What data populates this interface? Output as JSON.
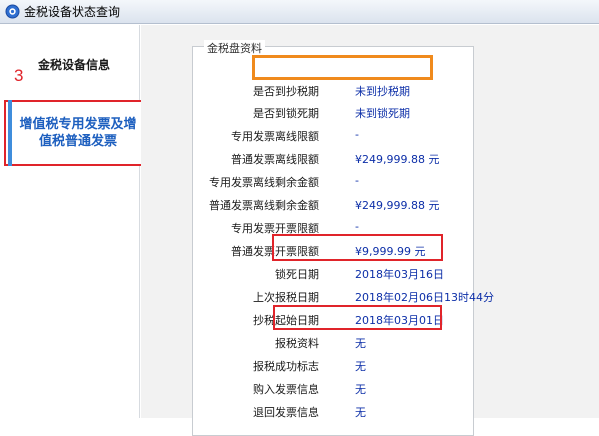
{
  "window": {
    "title": "金税设备状态查询"
  },
  "sidebar": {
    "header": "金税设备信息",
    "annotation": "3",
    "active_item": "增值税专用发票及增值税普通发票"
  },
  "panel": {
    "legend": "金税盘资料",
    "rows": [
      {
        "label": "是否到抄税期",
        "value": "未到抄税期"
      },
      {
        "label": "是否到锁死期",
        "value": "未到锁死期"
      },
      {
        "label": "专用发票离线限额",
        "value": "-"
      },
      {
        "label": "普通发票离线限额",
        "value": "¥249,999.88 元"
      },
      {
        "label": "专用发票离线剩余金额",
        "value": "-"
      },
      {
        "label": "普通发票离线剩余金额",
        "value": "¥249,999.88 元"
      },
      {
        "label": "专用发票开票限额",
        "value": "-"
      },
      {
        "label": "普通发票开票限额",
        "value": "¥9,999.99 元"
      },
      {
        "label": "锁死日期",
        "value": "2018年03月16日"
      },
      {
        "label": "上次报税日期",
        "value": "2018年02月06日13时44分"
      },
      {
        "label": "抄税起始日期",
        "value": "2018年03月01日"
      },
      {
        "label": "报税资料",
        "value": "无"
      },
      {
        "label": "报税成功标志",
        "value": "无"
      },
      {
        "label": "购入发票信息",
        "value": "无"
      },
      {
        "label": "退回发票信息",
        "value": "无"
      }
    ]
  },
  "colors": {
    "value_text": "#0d2fa8",
    "highlight_orange": "#f08a1c",
    "highlight_red": "#e0242a",
    "nav_active_text": "#1d5fbf"
  }
}
